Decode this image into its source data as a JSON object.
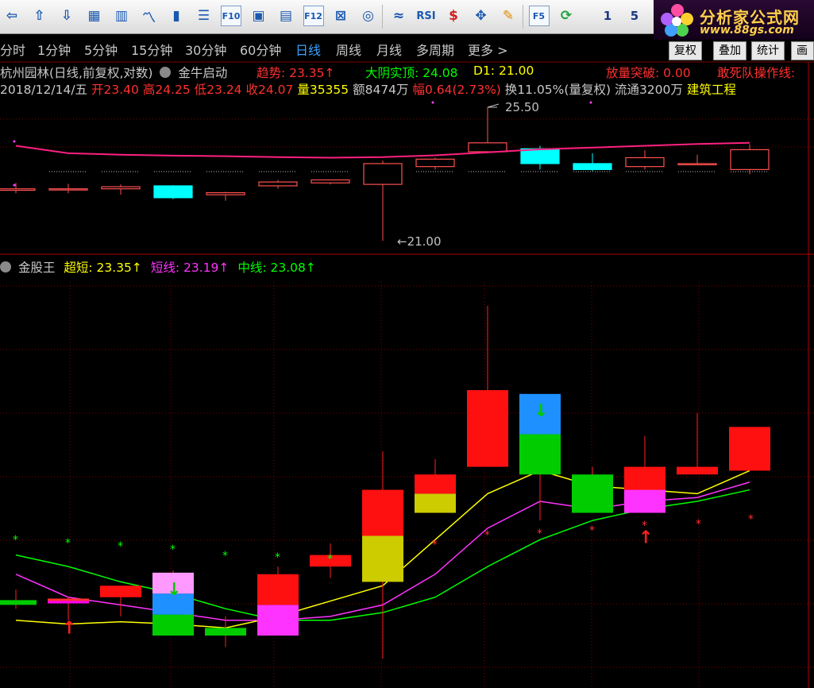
{
  "toolbar": {
    "icons": [
      "back-arrow-icon",
      "up-arrow-icon",
      "down-arrow-icon",
      "report-icon",
      "grid-icon",
      "trend-icon",
      "candles-icon",
      "list-icon",
      "f10-icon",
      "chart-doc-icon",
      "doc-icon",
      "f12-icon",
      "formula-icon",
      "circle-icon",
      "wave-icon",
      "rsi-icon",
      "dollar-icon",
      "cross-move-icon",
      "pencil-icon",
      "f5-icon",
      "refresh-icon"
    ],
    "labels": {
      "f10": "F10",
      "f12": "F12",
      "rsi": "RSI",
      "f5": "F5",
      "n1": "1",
      "n5": "5",
      "n1b": "1"
    }
  },
  "logo": {
    "title": "分析家公式网",
    "url": "www.88gs.com"
  },
  "periods": [
    "分时",
    "1分钟",
    "5分钟",
    "15分钟",
    "30分钟",
    "60分钟",
    "日线",
    "周线",
    "月线",
    "多周期",
    "更多 >"
  ],
  "active_period": "日线",
  "right_buttons": [
    "复权",
    "叠加",
    "统计",
    "画线"
  ],
  "header": {
    "title": "杭州园林(日线,前复权,对数)",
    "signal": "金牛启动",
    "trend_label": "趋势: ",
    "trend_value": "23.35↑",
    "dayin_label": "大阴实顶: ",
    "dayin_value": "24.08",
    "d1_label": "D1: ",
    "d1_value": "21.00",
    "fangliang_label": "放量突破: ",
    "fangliang_value": "0.00",
    "gansi_label": "敢死队操作线: "
  },
  "quote": {
    "date": "2018/12/14/五",
    "open_label": "开",
    "open": "23.40",
    "high_label": "高",
    "high": "24.25",
    "low_label": "低",
    "low": "23.24",
    "close_label": "收",
    "close": "24.07",
    "vol_label": "量",
    "vol": "35355",
    "amt_label": "额",
    "amt": "8474万",
    "chg_label": "幅",
    "chg": "0.64(2.73%)",
    "turnover": "换11.05%(量复权)",
    "float": "流通3200万",
    "sector": "建筑工程"
  },
  "indicator": {
    "name": "金股王",
    "ultra_label": "超短: ",
    "ultra": "23.35↑",
    "short_label": "短线: ",
    "short": "23.19↑",
    "mid_label": "中线: ",
    "mid": "23.08↑"
  },
  "colors": {
    "up": "#ff5050",
    "down": "#00ffff",
    "grid": "#800000",
    "ma": "#ff2080"
  },
  "chart_data": [
    {
      "type": "candlestick",
      "series": [
        {
          "name": "price",
          "values": [
            {
              "o": 22.7,
              "h": 22.95,
              "l": 22.6,
              "c": 22.75
            },
            {
              "o": 22.75,
              "h": 22.92,
              "l": 22.6,
              "c": 22.75
            },
            {
              "o": 22.75,
              "h": 22.9,
              "l": 22.55,
              "c": 22.82
            },
            {
              "o": 22.85,
              "h": 22.87,
              "l": 22.4,
              "c": 22.45
            },
            {
              "o": 22.55,
              "h": 22.65,
              "l": 22.35,
              "c": 22.62
            },
            {
              "o": 22.85,
              "h": 23.05,
              "l": 22.75,
              "c": 22.98
            },
            {
              "o": 22.95,
              "h": 23.05,
              "l": 22.9,
              "c": 23.05
            },
            {
              "o": 22.9,
              "h": 23.7,
              "l": 21.0,
              "c": 23.6
            },
            {
              "o": 23.5,
              "h": 23.8,
              "l": 23.4,
              "c": 23.75
            },
            {
              "o": 24.0,
              "h": 25.5,
              "l": 23.95,
              "c": 24.3
            },
            {
              "o": 24.1,
              "h": 24.2,
              "l": 23.4,
              "c": 23.6
            },
            {
              "o": 23.6,
              "h": 23.95,
              "l": 23.35,
              "c": 23.4
            },
            {
              "o": 23.5,
              "h": 24.05,
              "l": 23.4,
              "c": 23.8
            },
            {
              "o": 23.6,
              "h": 23.9,
              "l": 23.55,
              "c": 23.6
            },
            {
              "o": 23.4,
              "h": 24.25,
              "l": 23.24,
              "c": 24.07
            }
          ]
        }
      ],
      "annotations": [
        "25.50",
        "21.00"
      ]
    },
    {
      "type": "candlestick",
      "series": [
        {
          "name": "金股王",
          "values": [
            {
              "o": 22.1,
              "h": 22.3,
              "l": 22.05,
              "c": 22.1,
              "col": [
                "#00cc00"
              ]
            },
            {
              "o": 22.12,
              "h": 22.2,
              "l": 21.9,
              "c": 22.12,
              "col": [
                "#ff00ff",
                "#ff3030"
              ],
              "arrow": "up"
            },
            {
              "o": 22.2,
              "h": 22.3,
              "l": 21.95,
              "c": 22.35,
              "col": [
                "#ff1010"
              ]
            },
            {
              "o": 21.7,
              "h": 22.55,
              "l": 21.7,
              "c": 22.52,
              "col": [
                "#00cc00",
                "#1e90ff",
                "#ff99ff"
              ],
              "arrow": "down"
            },
            {
              "o": 21.7,
              "h": 21.95,
              "l": 21.55,
              "c": 21.8,
              "col": [
                "#00cc00"
              ]
            },
            {
              "o": 21.7,
              "h": 22.6,
              "l": 21.7,
              "c": 22.5,
              "col": [
                "#ff33ff",
                "#ff1010"
              ]
            },
            {
              "o": 22.6,
              "h": 22.9,
              "l": 22.45,
              "c": 22.75,
              "col": [
                "#ff1010"
              ]
            },
            {
              "o": 22.4,
              "h": 24.1,
              "l": 21.4,
              "c": 23.6,
              "col": [
                "#cccc00",
                "#ff1010"
              ]
            },
            {
              "o": 23.3,
              "h": 24.0,
              "l": 23.3,
              "c": 23.8,
              "col": [
                "#cccc00",
                "#ff1010"
              ]
            },
            {
              "o": 23.9,
              "h": 26.0,
              "l": 23.9,
              "c": 24.9,
              "col": [
                "#ff1010"
              ]
            },
            {
              "o": 23.8,
              "h": 24.85,
              "l": 23.2,
              "c": 24.85,
              "col": [
                "#00cc00",
                "#1e90ff"
              ],
              "arrow": "down"
            },
            {
              "o": 23.3,
              "h": 23.9,
              "l": 23.3,
              "c": 23.8,
              "col": [
                "#00cc00"
              ]
            },
            {
              "o": 23.3,
              "h": 24.3,
              "l": 23.3,
              "c": 23.9,
              "col": [
                "#ff33ff",
                "#ff1010"
              ],
              "arrow": "up"
            },
            {
              "o": 23.8,
              "h": 24.6,
              "l": 23.8,
              "c": 23.9,
              "col": [
                "#ff1010"
              ]
            },
            {
              "o": 23.85,
              "h": 24.3,
              "l": 23.85,
              "c": 24.42,
              "col": [
                "#ff1010"
              ]
            }
          ]
        },
        {
          "name": "超短",
          "values": [
            21.9,
            21.85,
            21.88,
            21.85,
            21.8,
            21.95,
            22.15,
            22.35,
            22.95,
            23.55,
            23.85,
            23.65,
            23.6,
            23.55,
            23.85
          ]
        },
        {
          "name": "短线",
          "values": [
            22.5,
            22.2,
            22.1,
            22.0,
            21.9,
            21.9,
            21.95,
            22.1,
            22.5,
            23.1,
            23.45,
            23.35,
            23.45,
            23.5,
            23.7
          ]
        },
        {
          "name": "中线",
          "values": [
            22.75,
            22.6,
            22.4,
            22.25,
            22.05,
            21.9,
            21.9,
            22.0,
            22.2,
            22.6,
            22.95,
            23.2,
            23.35,
            23.45,
            23.6
          ]
        }
      ]
    }
  ]
}
